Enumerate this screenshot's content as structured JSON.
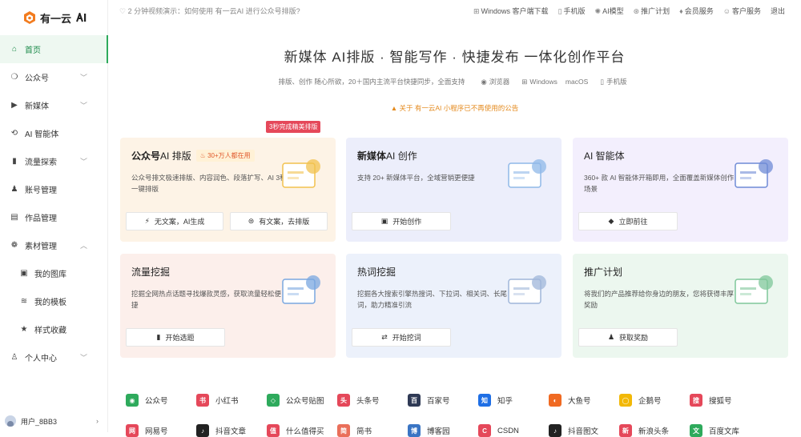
{
  "app": {
    "logo_text": "有一云"
  },
  "sidebar": {
    "items": [
      {
        "label": "首页",
        "icon": "home-icon",
        "glyph": "⌂",
        "active": true
      },
      {
        "label": "公众号",
        "icon": "wechat-icon",
        "glyph": "❍",
        "chevron": true
      },
      {
        "label": "新媒体",
        "icon": "play-icon",
        "glyph": "▶",
        "chevron": true
      },
      {
        "label": "AI 智能体",
        "icon": "ai-icon",
        "glyph": "⟲"
      },
      {
        "label": "流量探索",
        "icon": "bar-chart-icon",
        "glyph": "▮",
        "chevron": true
      },
      {
        "label": "账号管理",
        "icon": "users-icon",
        "glyph": "♟"
      },
      {
        "label": "作品管理",
        "icon": "document-icon",
        "glyph": "▤"
      },
      {
        "label": "素材管理",
        "icon": "palette-icon",
        "glyph": "❁",
        "chevron": true,
        "open": true
      },
      {
        "label": "我的图库",
        "icon": "image-icon",
        "glyph": "▣",
        "sub": true
      },
      {
        "label": "我的模板",
        "icon": "layers-icon",
        "glyph": "≋",
        "sub": true
      },
      {
        "label": "样式收藏",
        "icon": "star-icon",
        "glyph": "★",
        "sub": true
      },
      {
        "label": "个人中心",
        "icon": "person-icon",
        "glyph": "♙",
        "chevron": true
      }
    ],
    "user_name": "用户_8BB3"
  },
  "topbar": {
    "notice": "2 分钟视频演示：如何使用 有一云AI 进行公众号排版?",
    "links": [
      {
        "label": "Windows 客户端下载",
        "icon": "windows-icon",
        "glyph": "⊞"
      },
      {
        "label": "手机版",
        "icon": "phone-icon",
        "glyph": "▯"
      },
      {
        "label": "AI模型",
        "icon": "model-icon",
        "glyph": "✺"
      },
      {
        "label": "推广计划",
        "icon": "promo-icon",
        "glyph": "⊛"
      },
      {
        "label": "会员服务",
        "icon": "vip-icon",
        "glyph": "♦"
      },
      {
        "label": "客户服务",
        "icon": "service-icon",
        "glyph": "☺"
      },
      {
        "label": "退出",
        "icon": "",
        "glyph": ""
      }
    ]
  },
  "hero": {
    "title": "新媒体 AI排版 · 智能写作 · 快捷发布 一体化创作平台",
    "subtitle": "排版、创作 随心所欲，20＋国内主流平台快捷同步，全面支持",
    "platforms": [
      {
        "label": "浏览器",
        "glyph": "◉"
      },
      {
        "label": "Windows",
        "glyph": "⊞"
      },
      {
        "label": "macOS",
        "glyph": ""
      },
      {
        "label": "手机版",
        "glyph": "▯"
      }
    ],
    "announcement": "关于 有一云AI 小程序已不再使用的公告"
  },
  "top_tag": "3秒完成精美排版",
  "cards": [
    {
      "title_bold": "公众号",
      "title_rest": " AI 排版",
      "badge": "30+万人都在用",
      "desc": "公众号排文极速排版、内容润色、段落扩写、AI 3秒一键排版",
      "bg": "#fdf3e6",
      "buttons": [
        {
          "label": "无文案，AI生成",
          "glyph": "⚡"
        },
        {
          "label": "有文案，去排版",
          "glyph": "⊜"
        }
      ]
    },
    {
      "title_bold": "新媒体",
      "title_rest": " AI 创作",
      "badge": "",
      "desc": "支持 20+ 新媒体平台，全域营销更便捷",
      "bg": "#eceefb",
      "buttons": [
        {
          "label": "开始创作",
          "glyph": "▣"
        }
      ]
    },
    {
      "title_bold": "",
      "title_rest": "AI 智能体",
      "badge": "",
      "desc": "360+ 款 AI 智能体开箱即用，全面覆盖新媒体创作场景",
      "bg": "#f3effd",
      "buttons": [
        {
          "label": "立即前往",
          "glyph": "◆"
        }
      ]
    },
    {
      "title_bold": "",
      "title_rest": "流量挖掘",
      "badge": "",
      "desc": "挖掘全网热点话题寻找爆款灵感，获取流量轻松便捷",
      "bg": "#fcefeb",
      "buttons": [
        {
          "label": "开始选题",
          "glyph": "▮"
        }
      ]
    },
    {
      "title_bold": "",
      "title_rest": "热词挖掘",
      "badge": "",
      "desc": "挖掘各大搜索引擎热搜词、下拉词、相关词、长尾词，助力精准引流",
      "bg": "#ecf1fb",
      "buttons": [
        {
          "label": "开始挖词",
          "glyph": "⇄"
        }
      ]
    },
    {
      "title_bold": "",
      "title_rest": "推广计划",
      "badge": "",
      "desc": "将我们的产品推荐给你身边的朋友，您将获得丰厚奖励",
      "bg": "#ecf7ef",
      "buttons": [
        {
          "label": "获取奖励",
          "glyph": "♟"
        }
      ]
    }
  ],
  "platforms_row1": [
    {
      "label": "公众号",
      "color": "#2eaa5c",
      "glyph": "◉"
    },
    {
      "label": "小红书",
      "color": "#e5485a",
      "glyph": "书"
    },
    {
      "label": "公众号贴图",
      "color": "#2eaa5c",
      "glyph": "◇"
    },
    {
      "label": "头条号",
      "color": "#e5485a",
      "glyph": "头"
    },
    {
      "label": "百家号",
      "color": "#2f3a55",
      "glyph": "百"
    },
    {
      "label": "知乎",
      "color": "#1f6fe5",
      "glyph": "知"
    },
    {
      "label": "大鱼号",
      "color": "#f06a22",
      "glyph": "◐"
    },
    {
      "label": "企鹅号",
      "color": "#f2b807",
      "glyph": "◯"
    },
    {
      "label": "搜狐号",
      "color": "#e5485a",
      "glyph": "搜"
    }
  ],
  "platforms_row2": [
    {
      "label": "网易号",
      "color": "#e5485a",
      "glyph": "网"
    },
    {
      "label": "抖音文章",
      "color": "#222222",
      "glyph": "♪"
    },
    {
      "label": "什么值得买",
      "color": "#e5485a",
      "glyph": "值"
    },
    {
      "label": "简书",
      "color": "#ea6f5a",
      "glyph": "简"
    },
    {
      "label": "博客园",
      "color": "#3a75c4",
      "glyph": "博"
    },
    {
      "label": "CSDN",
      "color": "#e5485a",
      "glyph": "C"
    },
    {
      "label": "抖音图文",
      "color": "#222222",
      "glyph": "♪"
    },
    {
      "label": "新浪头条",
      "color": "#e5485a",
      "glyph": "新"
    },
    {
      "label": "百度文库",
      "color": "#2eaa5c",
      "glyph": "文"
    }
  ]
}
